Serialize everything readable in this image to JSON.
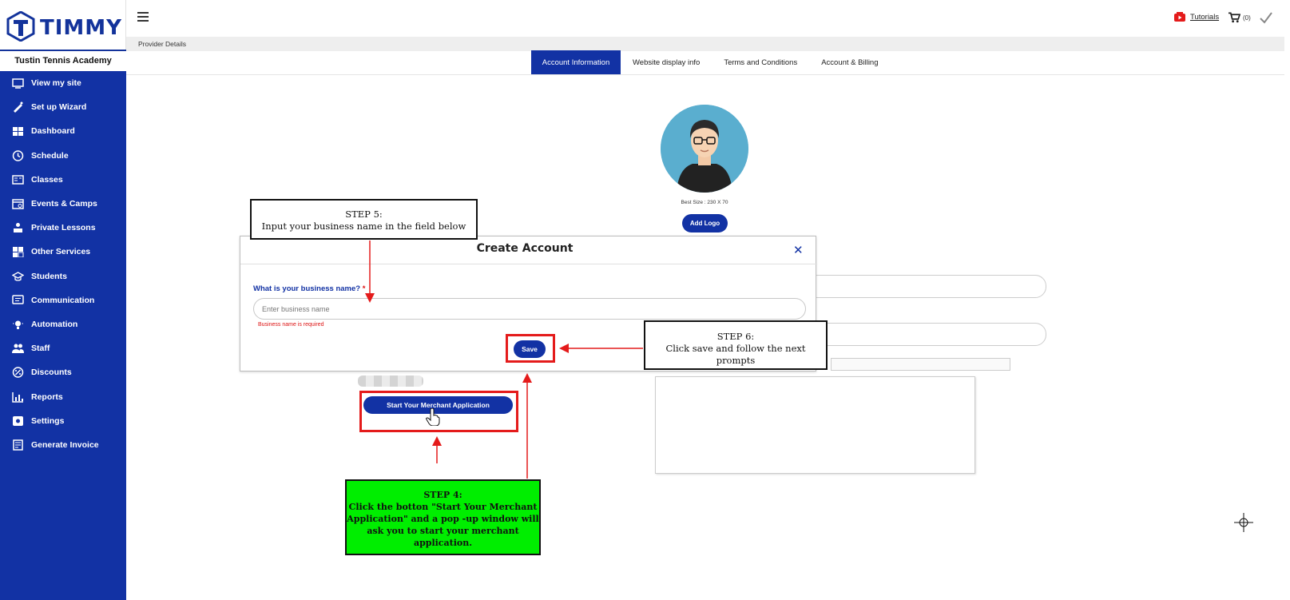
{
  "app": {
    "logo_text": "TIMMY",
    "org_name": "Tustin Tennis Academy"
  },
  "sidebar": {
    "items": [
      {
        "label": "View my site",
        "icon": "view-site-icon"
      },
      {
        "label": "Set up Wizard",
        "icon": "wizard-icon"
      },
      {
        "label": "Dashboard",
        "icon": "dashboard-icon"
      },
      {
        "label": "Schedule",
        "icon": "clock-icon"
      },
      {
        "label": "Classes",
        "icon": "classes-icon"
      },
      {
        "label": "Events & Camps",
        "icon": "calendar-icon"
      },
      {
        "label": "Private Lessons",
        "icon": "private-lessons-icon"
      },
      {
        "label": "Other Services",
        "icon": "services-icon"
      },
      {
        "label": "Students",
        "icon": "graduation-cap-icon"
      },
      {
        "label": "Communication",
        "icon": "chat-icon"
      },
      {
        "label": "Automation",
        "icon": "bulb-icon"
      },
      {
        "label": "Staff",
        "icon": "people-icon"
      },
      {
        "label": "Discounts",
        "icon": "percent-icon"
      },
      {
        "label": "Reports",
        "icon": "reports-icon"
      },
      {
        "label": "Settings",
        "icon": "settings-icon"
      },
      {
        "label": "Generate Invoice",
        "icon": "invoice-icon"
      }
    ]
  },
  "topbar": {
    "tutorials_label": "Tutorials",
    "cart_count": "(0)"
  },
  "breadcrumb": "Provider Details",
  "tabs": [
    {
      "label": "Account Information",
      "active": true
    },
    {
      "label": "Website display info",
      "active": false
    },
    {
      "label": "Terms and Conditions",
      "active": false
    },
    {
      "label": "Account & Billing",
      "active": false
    }
  ],
  "profile": {
    "best_size": "Best Size : 230 X 70",
    "add_logo_label": "Add Logo"
  },
  "modal": {
    "title": "Create Account",
    "close_symbol": "✕",
    "field_label": "What is your business name?",
    "required_mark": "*",
    "input_placeholder": "Enter business name",
    "error_text": "Business name is required",
    "save_label": "Save"
  },
  "merchant_button_label": "Start Your Merchant Application",
  "annotations": {
    "step5_title": "STEP 5:",
    "step5_text": "Input your business name in the field below",
    "step6_title": "STEP 6:",
    "step6_text": "Click save and follow the next prompts",
    "step4_title": "STEP 4:",
    "step4_text": "Click the botton \"Start Your Merchant Application\" and a pop -up window will ask you to start your merchant application."
  },
  "colors": {
    "brand_blue": "#1232a4",
    "highlight_red": "#e41b1b",
    "callout_green": "#00ee00",
    "error_red": "#dd1111"
  }
}
